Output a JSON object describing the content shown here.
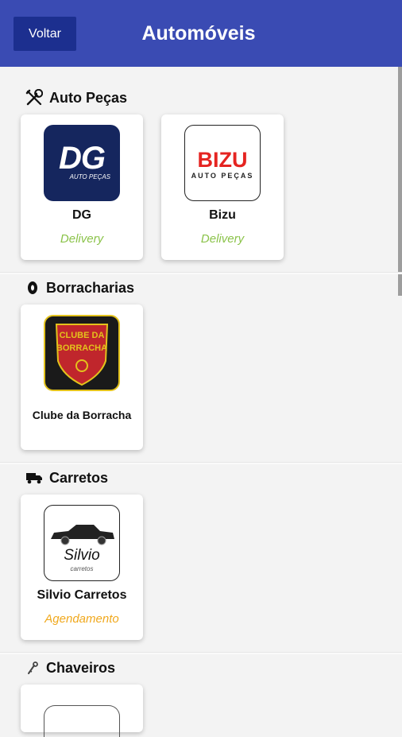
{
  "header": {
    "back_label": "Voltar",
    "title": "Automóveis",
    "color": "#3a4bb3",
    "back_color": "#1c2f8f"
  },
  "sections": [
    {
      "title": "Auto Peças",
      "icon": "tools-icon",
      "cards": [
        {
          "name": "DG",
          "tag": "Delivery",
          "logo_text": "DG",
          "logo_sub": "AUTO PEÇAS"
        },
        {
          "name": "Bizu",
          "tag": "Delivery",
          "logo_text": "BIZU",
          "logo_sub": "AUTO PEÇAS"
        }
      ]
    },
    {
      "title": "Borracharias",
      "icon": "tire-icon",
      "cards": [
        {
          "name": "Clube da Borracha",
          "logo_text_1": "CLUBE DA",
          "logo_text_2": "BORRACHA"
        }
      ]
    },
    {
      "title": "Carretos",
      "icon": "truck-icon",
      "cards": [
        {
          "name": "Silvio Carretos",
          "tag": "Agendamento",
          "logo_text": "Silvio",
          "logo_sub": "carretos"
        }
      ]
    },
    {
      "title": "Chaveiros",
      "icon": "key-icon",
      "cards": []
    }
  ],
  "colors": {
    "delivery": "#8bc34a",
    "agendamento": "#f0a81c"
  }
}
